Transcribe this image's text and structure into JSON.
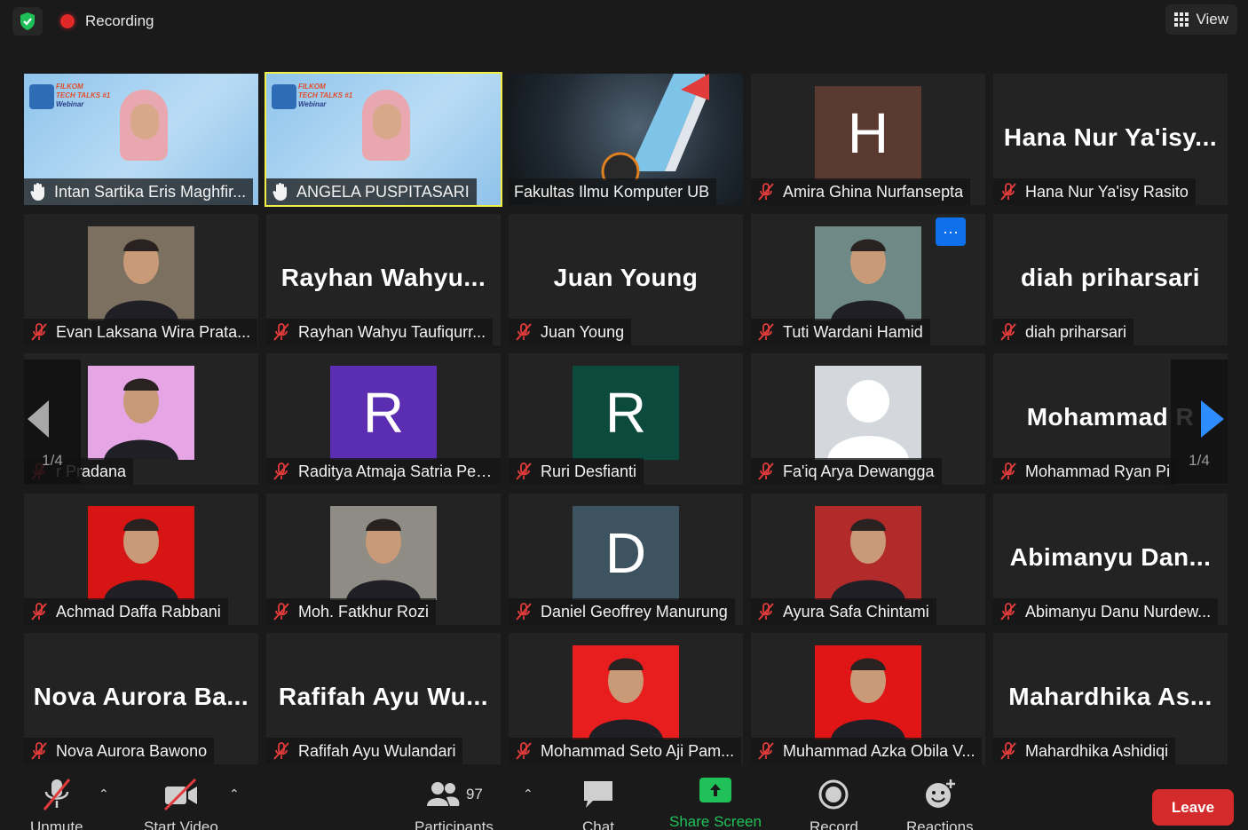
{
  "topbar": {
    "recording_label": "Recording",
    "view_label": "View"
  },
  "tiles": [
    {
      "label": "Intan Sartika Eris Maghfir...",
      "kind": "webinar",
      "icon": "raised-hand-icon"
    },
    {
      "label": "ANGELA PUSPITASARI",
      "kind": "webinar",
      "icon": "raised-hand-icon",
      "active": true
    },
    {
      "label": "Fakultas Ilmu Komputer UB",
      "kind": "film"
    },
    {
      "label": "Amira Ghina Nurfansepta",
      "kind": "letter",
      "letter": "H",
      "color": "#5a3a30"
    },
    {
      "label": "Hana Nur Ya'isy Rasito",
      "kind": "name",
      "big": "Hana  Nur  Ya'isy..."
    },
    {
      "label": "Evan Laksana Wira Prata...",
      "kind": "photo",
      "color": "#7c7060"
    },
    {
      "label": "Rayhan Wahyu Taufiqurr...",
      "kind": "name",
      "big": "Rayhan  Wahyu..."
    },
    {
      "label": "Juan Young",
      "kind": "name",
      "big": "Juan  Young"
    },
    {
      "label": "Tuti Wardani Hamid",
      "kind": "photo",
      "color": "#6f8a86",
      "more": true
    },
    {
      "label": "diah priharsari",
      "kind": "name",
      "big": "diah  priharsari"
    },
    {
      "label": "r Pradana",
      "kind": "photo",
      "color": "#e6a6e6"
    },
    {
      "label": "Raditya Atmaja Satria Per...",
      "kind": "letter",
      "letter": "R",
      "color": "#5b2eb1"
    },
    {
      "label": "Ruri Desfianti",
      "kind": "letter",
      "letter": "R",
      "color": "#0c4a3e"
    },
    {
      "label": "Fa'iq Arya Dewangga",
      "kind": "silhouette",
      "color": "#d4d7dc"
    },
    {
      "label": "Mohammad Ryan Pi",
      "kind": "name",
      "big": "Mohammad  R"
    },
    {
      "label": "Achmad Daffa Rabbani",
      "kind": "photo",
      "color": "#d81515"
    },
    {
      "label": "Moh. Fatkhur Rozi",
      "kind": "photo",
      "color": "#8f8c86"
    },
    {
      "label": "Daniel Geoffrey Manurung",
      "kind": "letter",
      "letter": "D",
      "color": "#3d5360"
    },
    {
      "label": "Ayura Safa Chintami",
      "kind": "photo",
      "color": "#b32a2a"
    },
    {
      "label": "Abimanyu Danu Nurdew...",
      "kind": "name",
      "big": "Abimanyu  Dan..."
    },
    {
      "label": "Nova Aurora Bawono",
      "kind": "name",
      "big": "Nova  Aurora  Ba..."
    },
    {
      "label": "Rafifah Ayu Wulandari",
      "kind": "name",
      "big": "Rafifah  Ayu  Wu..."
    },
    {
      "label": "Mohammad Seto Aji Pam...",
      "kind": "photo",
      "color": "#e81e1e"
    },
    {
      "label": "Muhammad Azka Obila V...",
      "kind": "photo",
      "color": "#e01515"
    },
    {
      "label": "Mahardhika Ashidiqi",
      "kind": "name",
      "big": "Mahardhika  As..."
    }
  ],
  "pager": {
    "left_label": "1/4",
    "right_label": "1/4"
  },
  "webinar": {
    "title_line1": "FILKOM",
    "title_line2": "TECH TALKS #1",
    "title_line3": "Webinar"
  },
  "toolbar": {
    "unmute": "Unmute",
    "start_video": "Start Video",
    "participants": "Participants",
    "participants_count": "97",
    "chat": "Chat",
    "share_screen": "Share Screen",
    "record": "Record",
    "reactions": "Reactions",
    "leave": "Leave"
  },
  "colors": {
    "active_speaker": "#f2ef48",
    "share_green": "#20c158",
    "leave_red": "#d32b2b",
    "accent_blue": "#0e71eb"
  }
}
